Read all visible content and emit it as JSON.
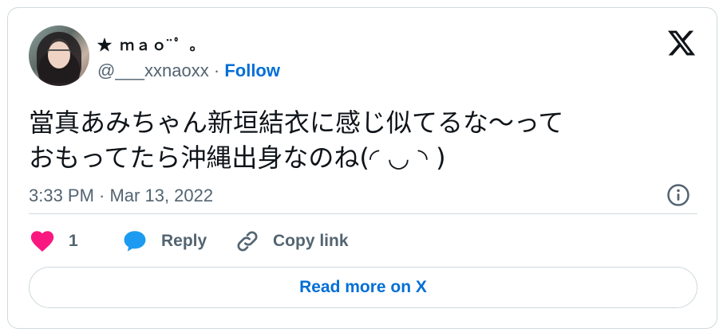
{
  "author": {
    "display_name": "★ ｍａｏ ̈ﾟ ｡",
    "handle": "@___xxnaoxx",
    "separator": "·",
    "follow_label": "Follow"
  },
  "tweet": {
    "line1": "當真あみちゃん新垣結衣に感じ似てるな〜って",
    "line2": "おもってたら沖縄出身なのね(◜ ◡ ◝ )",
    "timestamp": "3:33 PM · Mar 13, 2022"
  },
  "actions": {
    "like_count": "1",
    "reply_label": "Reply",
    "copy_link_label": "Copy link"
  },
  "read_more_label": "Read more on X",
  "colors": {
    "like": "#f91880",
    "reply": "#1d9bf0",
    "link": "#006fd6",
    "muted": "#536471",
    "border": "#cfd9de"
  }
}
